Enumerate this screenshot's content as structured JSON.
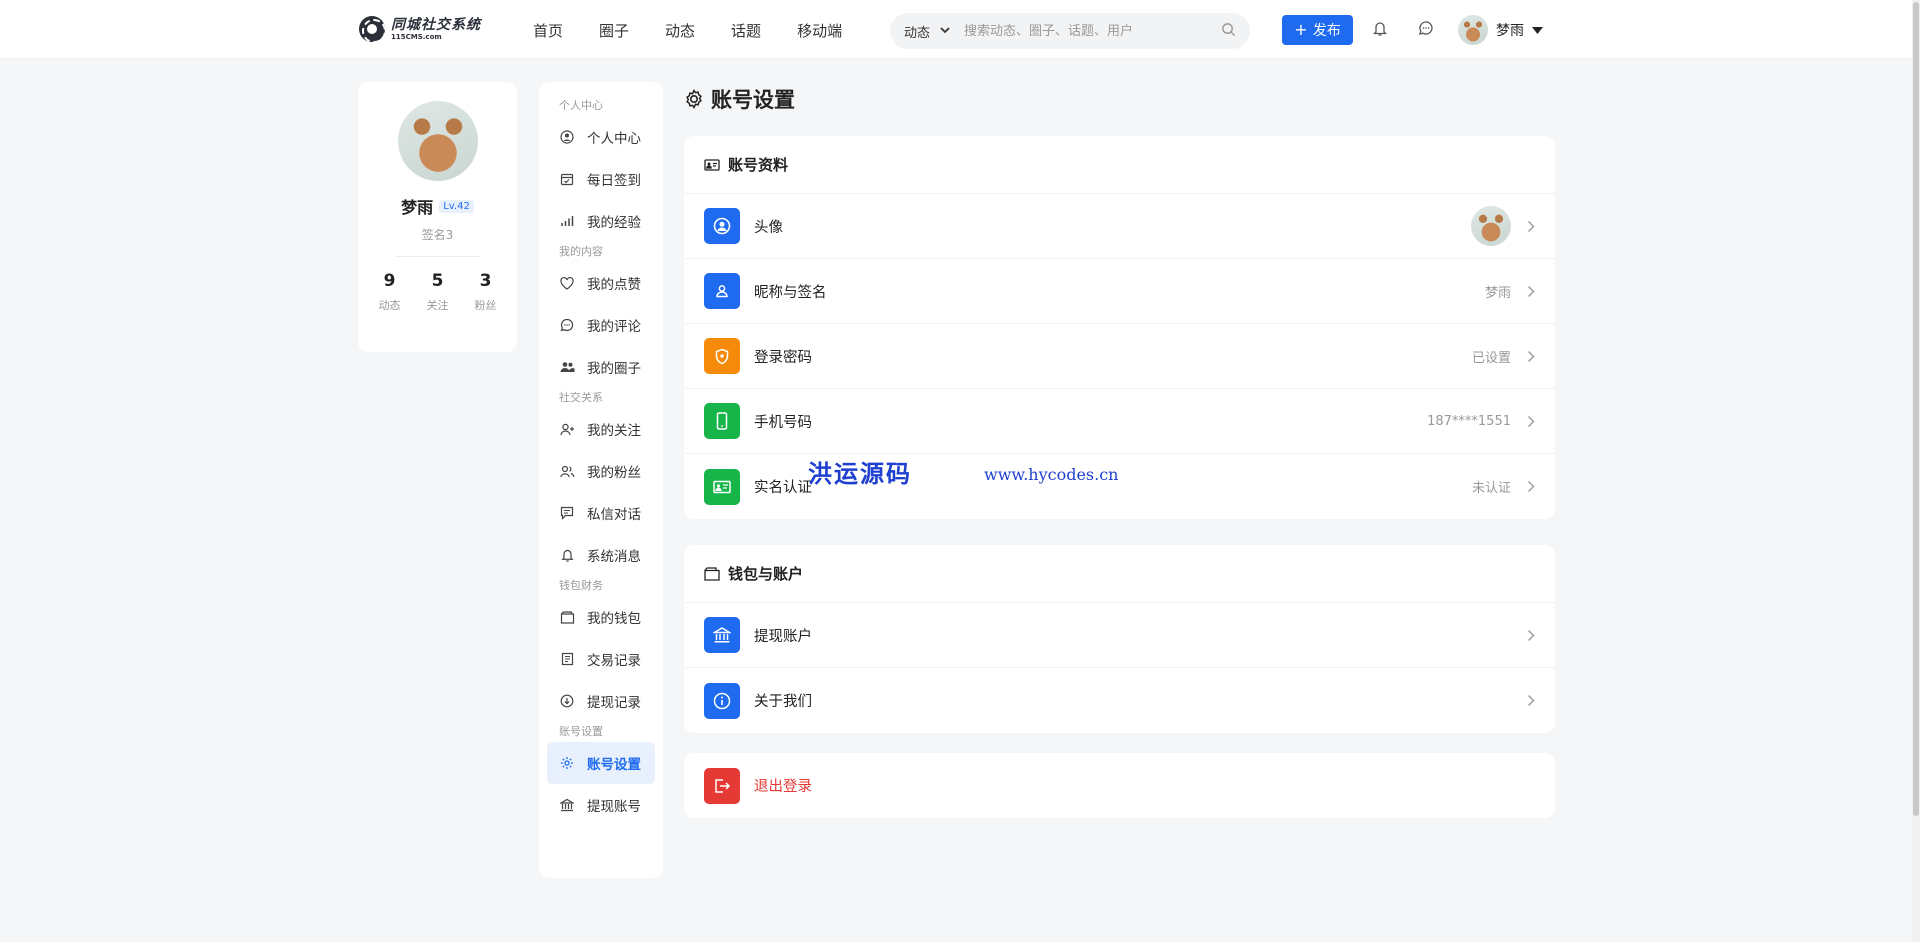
{
  "brand": {
    "title": "同城社交系统",
    "subtitle": "115CMS.com"
  },
  "nav": [
    "首页",
    "圈子",
    "动态",
    "话题",
    "移动端"
  ],
  "search": {
    "type": "动态",
    "placeholder": "搜索动态、圈子、话题、用户"
  },
  "header": {
    "publish_label": "发布",
    "username": "梦雨"
  },
  "profile": {
    "name": "梦雨",
    "level": "Lv.42",
    "signature": "签名3",
    "stats": [
      {
        "num": "9",
        "label": "动态"
      },
      {
        "num": "5",
        "label": "关注"
      },
      {
        "num": "3",
        "label": "粉丝"
      }
    ]
  },
  "menu": {
    "groups": [
      "个人中心",
      "我的内容",
      "社交关系",
      "钱包财务",
      "账号设置"
    ],
    "items": {
      "profile_center": "个人中心",
      "checkin": "每日签到",
      "experience": "我的经验",
      "likes": "我的点赞",
      "comments": "我的评论",
      "circles": "我的圈子",
      "following": "我的关注",
      "fans": "我的粉丝",
      "messages": "私信对话",
      "notices": "系统消息",
      "wallet": "我的钱包",
      "transactions": "交易记录",
      "withdraw_records": "提现记录",
      "account_settings": "账号设置",
      "withdraw_account": "提现账号"
    }
  },
  "page": {
    "title": "账号设置"
  },
  "account_section": {
    "title": "账号资料",
    "rows": {
      "avatar": {
        "label": "头像"
      },
      "nickname": {
        "label": "昵称与签名",
        "value": "梦雨"
      },
      "password": {
        "label": "登录密码",
        "value": "已设置"
      },
      "phone": {
        "label": "手机号码",
        "value": "187****1551"
      },
      "realname": {
        "label": "实名认证",
        "value": "未认证"
      }
    }
  },
  "wallet_section": {
    "title": "钱包与账户",
    "rows": {
      "withdraw": {
        "label": "提现账户"
      },
      "about": {
        "label": "关于我们"
      }
    }
  },
  "logout": {
    "label": "退出登录"
  },
  "watermark": {
    "text": "洪运源码",
    "url": "www.hycodes.cn"
  },
  "colors": {
    "primary": "#1e6bf0",
    "orange": "#f58a0b",
    "green": "#17b44a",
    "red": "#e53935"
  }
}
